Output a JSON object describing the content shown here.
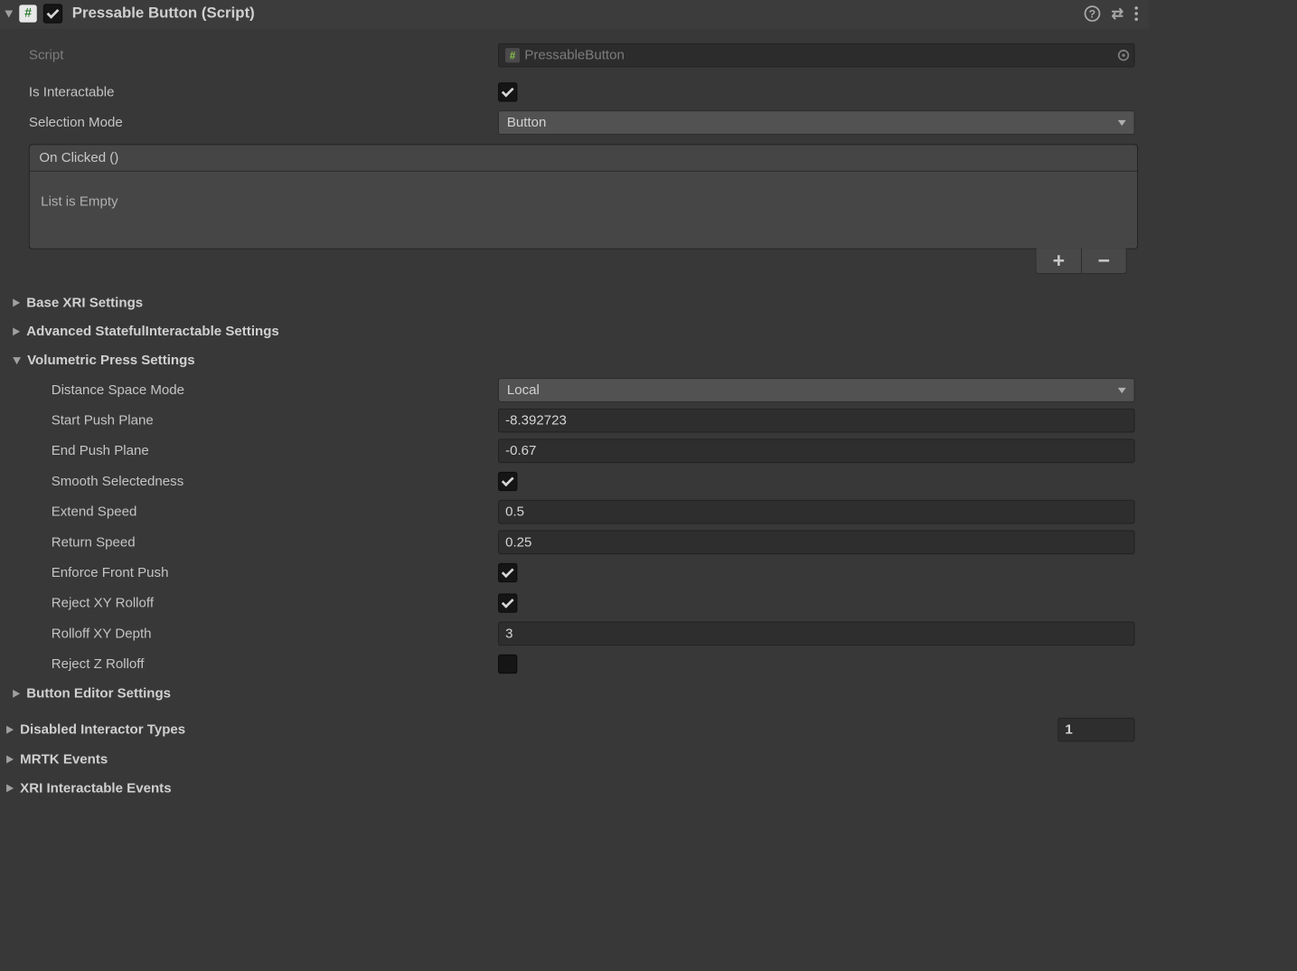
{
  "header": {
    "title": "Pressable Button (Script)",
    "script_icon": "#",
    "enabled": true
  },
  "fields": {
    "script_label": "Script",
    "script_value": "PressableButton",
    "is_interactable_label": "Is Interactable",
    "is_interactable": true,
    "selection_mode_label": "Selection Mode",
    "selection_mode_value": "Button"
  },
  "event": {
    "title": "On Clicked ()",
    "empty_text": "List is Empty",
    "plus": "+",
    "minus": "−"
  },
  "sections": {
    "base_xri": "Base XRI Settings",
    "advanced_stateful": "Advanced StatefulInteractable Settings",
    "volumetric": "Volumetric Press Settings",
    "button_editor": "Button Editor Settings",
    "disabled_interactors": "Disabled Interactor Types",
    "disabled_interactors_count": "1",
    "mrtk_events": "MRTK Events",
    "xri_events": "XRI Interactable Events"
  },
  "volumetric": {
    "distance_space_mode_label": "Distance Space Mode",
    "distance_space_mode_value": "Local",
    "start_push_plane_label": "Start Push Plane",
    "start_push_plane_value": "-8.392723",
    "end_push_plane_label": "End Push Plane",
    "end_push_plane_value": "-0.67",
    "smooth_selectedness_label": "Smooth Selectedness",
    "smooth_selectedness": true,
    "extend_speed_label": "Extend Speed",
    "extend_speed_value": "0.5",
    "return_speed_label": "Return Speed",
    "return_speed_value": "0.25",
    "enforce_front_push_label": "Enforce Front Push",
    "enforce_front_push": true,
    "reject_xy_rolloff_label": "Reject XY Rolloff",
    "reject_xy_rolloff": true,
    "rolloff_xy_depth_label": "Rolloff XY Depth",
    "rolloff_xy_depth_value": "3",
    "reject_z_rolloff_label": "Reject Z Rolloff",
    "reject_z_rolloff": false
  }
}
